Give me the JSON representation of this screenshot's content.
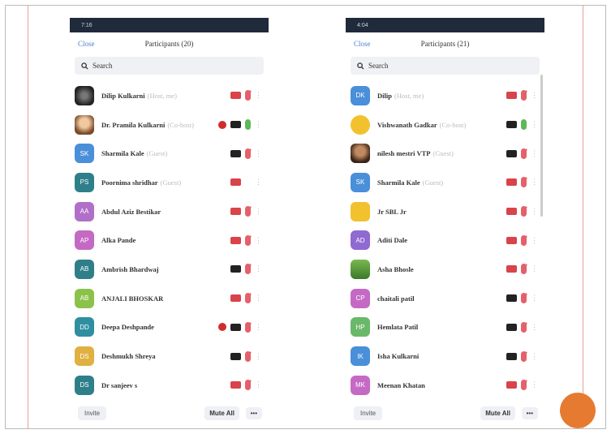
{
  "left": {
    "status": {
      "time": "7:16",
      "right": ""
    },
    "close": "Close",
    "title": "Participants (20)",
    "search_placeholder": "Search",
    "invite": "Invite",
    "mute_all": "Mute All",
    "more": "•••",
    "participants": [
      {
        "initials": "",
        "name": "Dilip Kulkarni",
        "tag": "(Host, me)",
        "color": "#333",
        "photo": "dark",
        "cam": "off",
        "mic": "off",
        "rec": false
      },
      {
        "initials": "",
        "name": "Dr. Pramila Kulkarni",
        "tag": "(Co-host)",
        "color": "#c98b5a",
        "photo": "face",
        "cam": "on",
        "mic": "on",
        "rec": true
      },
      {
        "initials": "SK",
        "name": "Sharmila Kale",
        "tag": "(Guest)",
        "color": "#4a8fd9",
        "cam": "on",
        "mic": "off",
        "rec": false
      },
      {
        "initials": "PS",
        "name": "Poornima shridhar",
        "tag": "(Guest)",
        "color": "#2e7f8a",
        "cam": "off",
        "mic": "",
        "rec": false
      },
      {
        "initials": "AA",
        "name": "Abdul Aziz Bestikar",
        "tag": "",
        "color": "#b06fc8",
        "cam": "off",
        "mic": "off",
        "rec": false
      },
      {
        "initials": "AP",
        "name": "Alka Pande",
        "tag": "",
        "color": "#c56ac4",
        "cam": "off",
        "mic": "off",
        "rec": false
      },
      {
        "initials": "AB",
        "name": "Ambrish Bhardwaj",
        "tag": "",
        "color": "#2e7f8a",
        "cam": "on",
        "mic": "off",
        "rec": false
      },
      {
        "initials": "AB",
        "name": "ANJALI BHOSKAR",
        "tag": "",
        "color": "#8bc24a",
        "cam": "off",
        "mic": "off",
        "rec": false
      },
      {
        "initials": "DD",
        "name": "Deepa Deshpande",
        "tag": "",
        "color": "#2e8fa0",
        "cam": "on",
        "mic": "off",
        "rec": true
      },
      {
        "initials": "DS",
        "name": "Deshmukh Shreya",
        "tag": "",
        "color": "#e0b040",
        "cam": "on",
        "mic": "off",
        "rec": false
      },
      {
        "initials": "DS",
        "name": "Dr sanjeev s",
        "tag": "",
        "color": "#2e7f8a",
        "cam": "off",
        "mic": "off",
        "rec": false
      }
    ]
  },
  "right": {
    "status": {
      "time": "4:04",
      "right": ""
    },
    "close": "Close",
    "title": "Participants (21)",
    "search_placeholder": "Search",
    "invite": "Invite",
    "mute_all": "Mute All",
    "more": "•••",
    "participants": [
      {
        "initials": "DK",
        "name": "Dilip",
        "tag": "(Host, me)",
        "color": "#4a8fd9",
        "cam": "off",
        "mic": "off",
        "rec": false
      },
      {
        "initials": "",
        "name": "Vishwanath Gadkar",
        "tag": "(Co-host)",
        "color": "#f0c020",
        "photo": "emoji",
        "cam": "on",
        "mic": "on",
        "rec": false
      },
      {
        "initials": "",
        "name": "nilesh mestri VTP",
        "tag": "(Guest)",
        "color": "#5a3a2a",
        "photo": "face2",
        "cam": "on",
        "mic": "off",
        "rec": false
      },
      {
        "initials": "SK",
        "name": "Sharmila Kale",
        "tag": "(Guest)",
        "color": "#4a8fd9",
        "cam": "off",
        "mic": "off",
        "rec": false
      },
      {
        "initials": "",
        "name": "Jr SBL Jr",
        "tag": "",
        "color": "#f2c12e",
        "cam": "off",
        "mic": "off",
        "rec": false
      },
      {
        "initials": "AD",
        "name": "Aditi Dale",
        "tag": "",
        "color": "#8f6ad0",
        "cam": "off",
        "mic": "off",
        "rec": false
      },
      {
        "initials": "",
        "name": "Asha Bhosle",
        "tag": "",
        "color": "#5aa040",
        "photo": "green",
        "cam": "off",
        "mic": "off",
        "rec": false
      },
      {
        "initials": "CP",
        "name": "chaitali patil",
        "tag": "",
        "color": "#c56ac4",
        "cam": "on",
        "mic": "off",
        "rec": false
      },
      {
        "initials": "HP",
        "name": "Hemlata Patil",
        "tag": "",
        "color": "#6ab86a",
        "cam": "on",
        "mic": "off",
        "rec": false
      },
      {
        "initials": "IK",
        "name": "Isha Kulkarni",
        "tag": "",
        "color": "#4a8fd9",
        "cam": "on",
        "mic": "off",
        "rec": false
      },
      {
        "initials": "MK",
        "name": "Meenan Khatan",
        "tag": "",
        "color": "#c56ac4",
        "cam": "off",
        "mic": "off",
        "rec": false
      }
    ]
  }
}
